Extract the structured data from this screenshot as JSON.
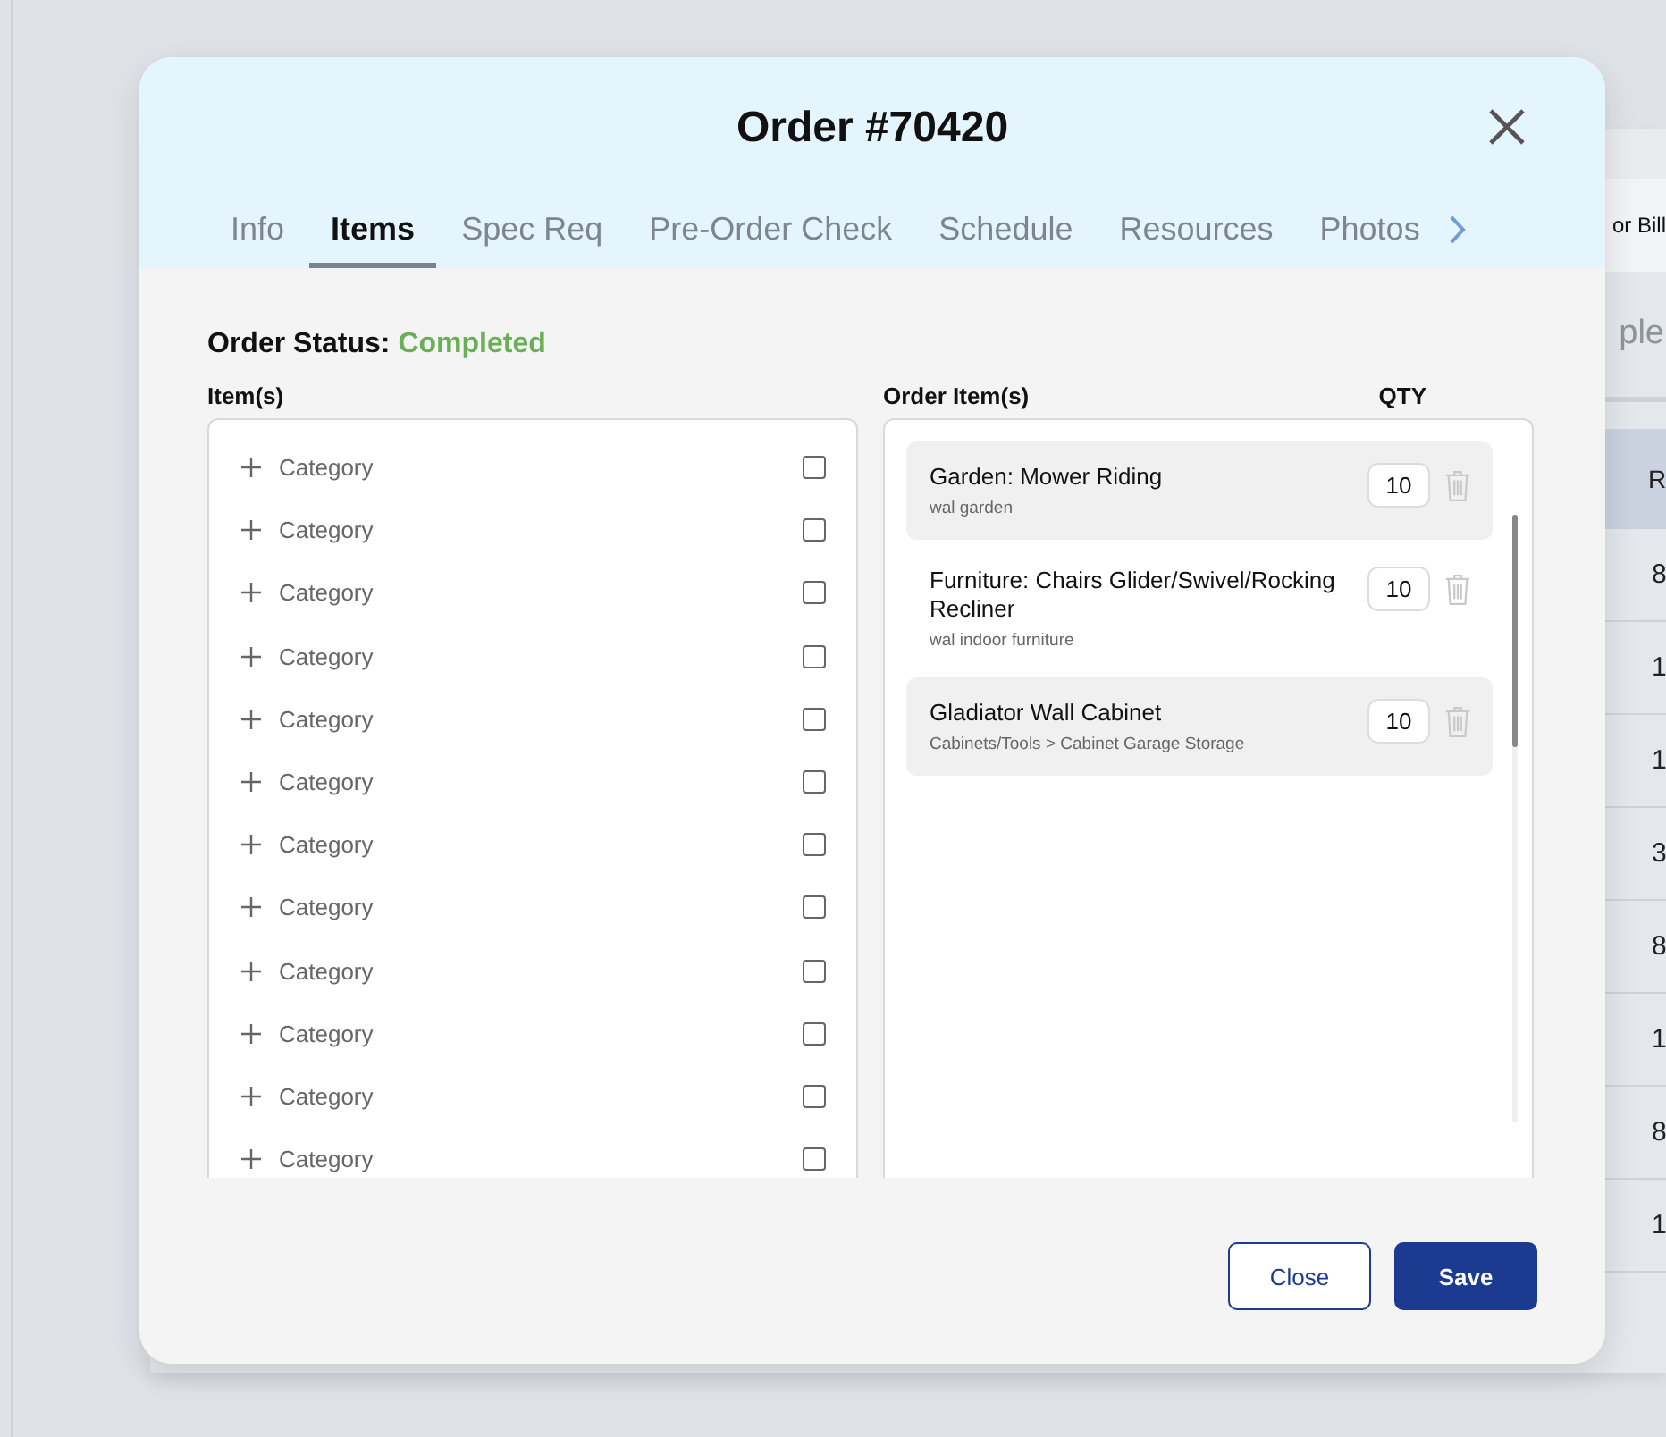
{
  "background_page": {
    "header_text": "or Bill",
    "tab_text": "ple",
    "table": {
      "column_1": "R",
      "rows": [
        "8",
        "1",
        "1",
        "3",
        "8",
        "1",
        "8",
        "1"
      ]
    }
  },
  "dialog": {
    "title": "Order #70420",
    "tabs": [
      {
        "label": "Info",
        "selected": false
      },
      {
        "label": "Items",
        "selected": true
      },
      {
        "label": "Spec Req",
        "selected": false
      },
      {
        "label": "Pre-Order Check",
        "selected": false
      },
      {
        "label": "Schedule",
        "selected": false
      },
      {
        "label": "Resources",
        "selected": false
      },
      {
        "label": "Photos",
        "selected": false
      }
    ],
    "status_label": "Order Status:",
    "status_value": "Completed",
    "items_heading": "Item(s)",
    "categories": [
      {
        "label": "Category",
        "checked": false
      },
      {
        "label": "Category",
        "checked": false
      },
      {
        "label": "Category",
        "checked": false
      },
      {
        "label": "Category",
        "checked": false
      },
      {
        "label": "Category",
        "checked": false
      },
      {
        "label": "Category",
        "checked": false
      },
      {
        "label": "Category",
        "checked": false
      },
      {
        "label": "Category",
        "checked": false
      },
      {
        "label": "Category",
        "checked": false
      },
      {
        "label": "Category",
        "checked": false
      },
      {
        "label": "Category",
        "checked": false
      },
      {
        "label": "Category",
        "checked": false
      }
    ],
    "order_items_heading": "Order Item(s)",
    "qty_heading": "QTY",
    "order_items": [
      {
        "name": "Garden: Mower Riding",
        "category": "wal garden",
        "qty": "10",
        "highlighted": true
      },
      {
        "name": "Furniture: Chairs Glider/Swivel/Rocking Recliner",
        "category": "wal indoor furniture",
        "qty": "10",
        "highlighted": false
      },
      {
        "name": "Gladiator Wall Cabinet",
        "category": "Cabinets/Tools > Cabinet Garage Storage",
        "qty": "10",
        "highlighted": true
      }
    ],
    "buttons": [
      {
        "label": "Close",
        "kind": "secondary"
      },
      {
        "label": "Save",
        "kind": "primary"
      }
    ]
  }
}
